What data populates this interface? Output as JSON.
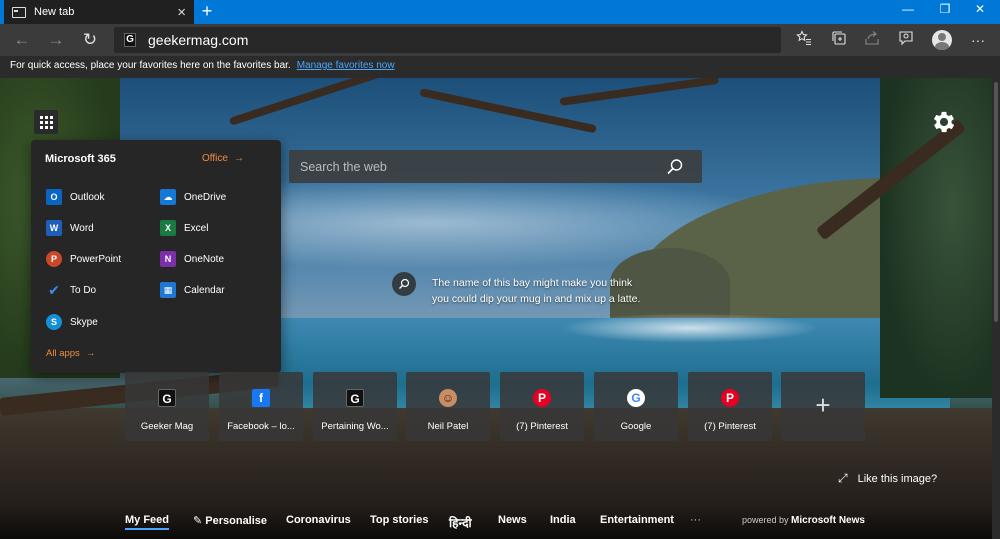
{
  "tab": {
    "title": "New tab",
    "close": "×",
    "new": "+"
  },
  "window": {
    "minimize": "—",
    "restore": "❐",
    "close": "✕"
  },
  "toolbar": {
    "back": "←",
    "forward": "→",
    "refresh": "↻",
    "url": "geekermag.com",
    "site_icon_letter": "G",
    "more": "···"
  },
  "favbar": {
    "text": "For quick access, place your favorites here on the favorites bar.",
    "link": "Manage favorites now"
  },
  "m365": {
    "title": "Microsoft 365",
    "office_link": "Office",
    "arrow": "→",
    "all_apps": "All apps",
    "apps": [
      {
        "label": "Outlook",
        "letter": "O",
        "color": "#0a64c4"
      },
      {
        "label": "OneDrive",
        "letter": "☁",
        "color": "#1479d6"
      },
      {
        "label": "Word",
        "letter": "W",
        "color": "#1e5fba"
      },
      {
        "label": "Excel",
        "letter": "X",
        "color": "#1a7a43"
      },
      {
        "label": "PowerPoint",
        "letter": "P",
        "color": "#c9472b"
      },
      {
        "label": "OneNote",
        "letter": "N",
        "color": "#7b2fa8"
      },
      {
        "label": "To Do",
        "letter": "✔",
        "color": "#2a6fd6"
      },
      {
        "label": "Calendar",
        "letter": "▦",
        "color": "#1e77d0"
      },
      {
        "label": "Skype",
        "letter": "S",
        "color": "#1490d6"
      }
    ]
  },
  "search": {
    "placeholder": "Search the web"
  },
  "image_info": {
    "text": "The name of this bay might make you think you could dip your mug in and mix up a latte."
  },
  "tiles": [
    {
      "label": "Geeker Mag",
      "letter": "G",
      "bg": "#111111",
      "fg": "#ffffff"
    },
    {
      "label": "Facebook – lo...",
      "letter": "f",
      "bg": "#1877f2",
      "fg": "#ffffff"
    },
    {
      "label": "Pertaining Wo...",
      "letter": "G",
      "bg": "#111111",
      "fg": "#ffffff"
    },
    {
      "label": "Neil Patel",
      "letter": "☺",
      "bg": "#c98d64",
      "fg": "#3b2618"
    },
    {
      "label": "(7) Pinterest",
      "letter": "P",
      "bg": "#e60023",
      "fg": "#ffffff"
    },
    {
      "label": "Google",
      "letter": "G",
      "bg": "#ffffff",
      "fg": "#4285f4"
    },
    {
      "label": "(7) Pinterest",
      "letter": "P",
      "bg": "#e60023",
      "fg": "#ffffff"
    }
  ],
  "add_tile": "+",
  "like": {
    "text": "Like this image?",
    "icon": "⤢"
  },
  "feed": {
    "items": [
      "My Feed",
      "✎ Personalise",
      "Coronavirus",
      "Top stories",
      "हिन्दी",
      "News",
      "India",
      "Entertainment",
      "···"
    ],
    "powered_by": "powered by",
    "brand": "Microsoft News"
  },
  "colors": {
    "accent": "#0078d7",
    "link": "#4aa6ff",
    "office_orange": "#f28b43"
  }
}
